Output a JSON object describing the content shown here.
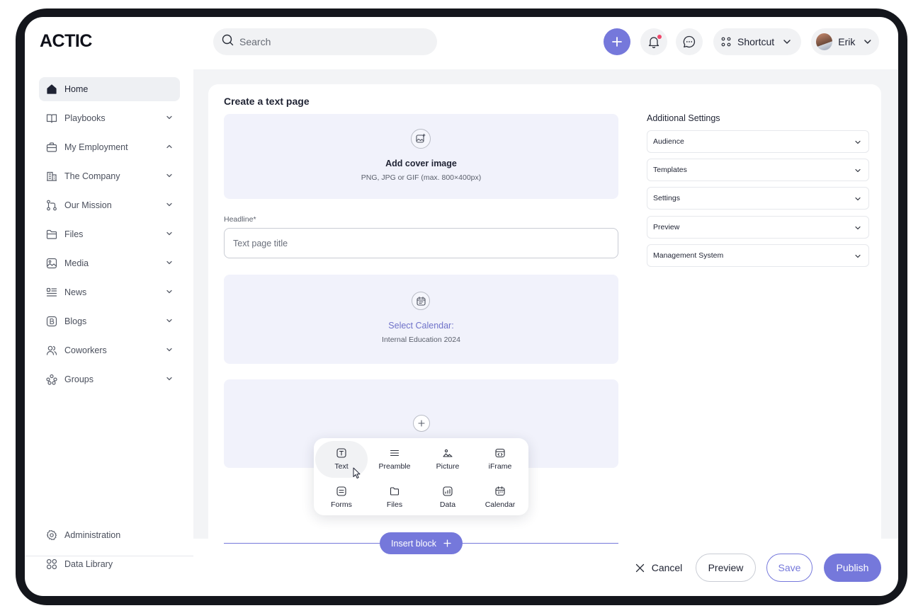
{
  "brand": {
    "logo": "ACTIC"
  },
  "header": {
    "search_placeholder": "Search",
    "shortcut_label": "Shortcut",
    "user_name": "Erik"
  },
  "sidebar": {
    "items": [
      {
        "label": "Home",
        "active": true
      },
      {
        "label": "Playbooks"
      },
      {
        "label": "My Employment",
        "expanded": true
      },
      {
        "label": "The Company"
      },
      {
        "label": "Our Mission"
      },
      {
        "label": "Files"
      },
      {
        "label": "Media"
      },
      {
        "label": "News"
      },
      {
        "label": "Blogs"
      },
      {
        "label": "Coworkers"
      },
      {
        "label": "Groups"
      }
    ],
    "bottom": [
      {
        "label": "Administration"
      },
      {
        "label": "Data Library"
      }
    ]
  },
  "main": {
    "title": "Create a text page",
    "cover": {
      "title": "Add cover image",
      "hint": "PNG, JPG or GIF (max. 800×400px)"
    },
    "headline": {
      "label": "Headline*",
      "placeholder": "Text page title",
      "value": ""
    },
    "calendar": {
      "title": "Select Calendar:",
      "value": "Internal Education 2024"
    },
    "blocks": [
      {
        "label": "Text",
        "icon": "text-block-icon"
      },
      {
        "label": "Preamble",
        "icon": "preamble-icon"
      },
      {
        "label": "Picture",
        "icon": "picture-icon"
      },
      {
        "label": "iFrame",
        "icon": "iframe-icon"
      },
      {
        "label": "Forms",
        "icon": "forms-icon"
      },
      {
        "label": "Files",
        "icon": "folder-icon"
      },
      {
        "label": "Data",
        "icon": "data-chart-icon"
      },
      {
        "label": "Calendar",
        "icon": "calendar-icon"
      }
    ],
    "insert_block_label": "Insert block"
  },
  "settings": {
    "title": "Additional Settings",
    "items": [
      "Audience",
      "Templates",
      "Settings",
      "Preview",
      "Management System"
    ]
  },
  "actions": {
    "cancel": "Cancel",
    "preview": "Preview",
    "save": "Save",
    "publish": "Publish"
  },
  "colors": {
    "accent": "#7578db",
    "panel_bg": "#f1f2fb",
    "frame": "#14161c",
    "notification_dot": "#f0476a"
  }
}
